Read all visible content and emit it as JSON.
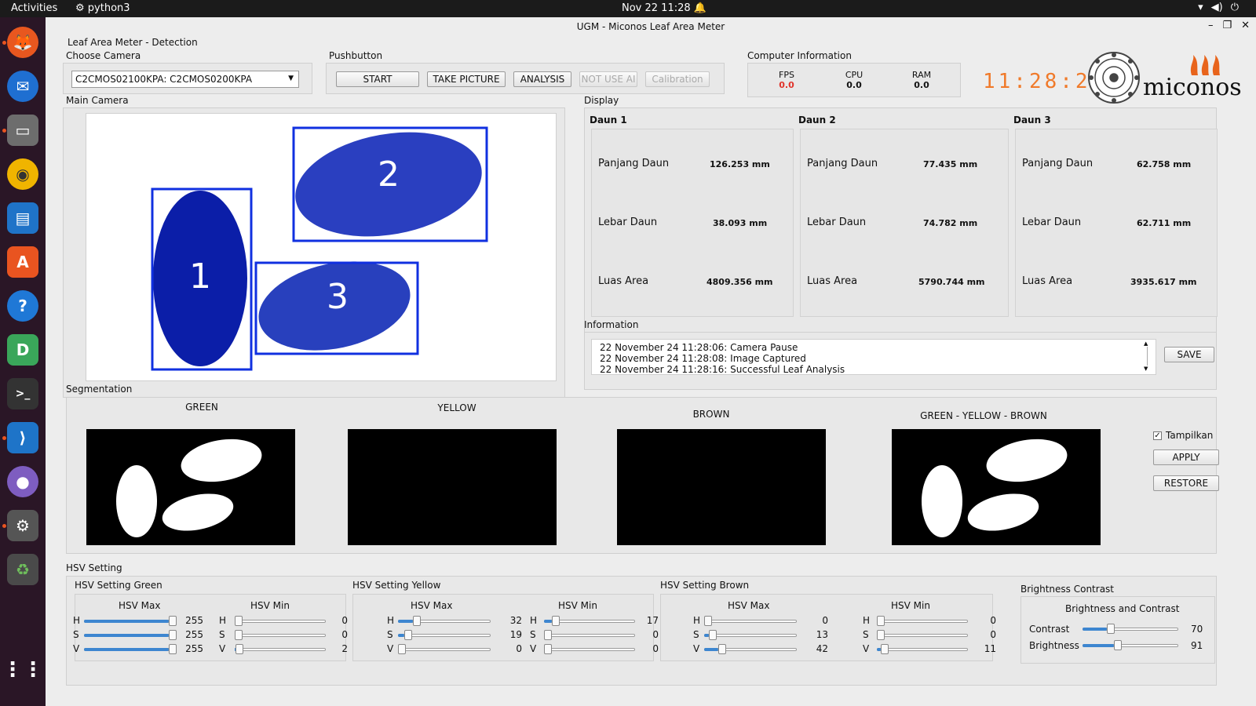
{
  "system": {
    "activities": "Activities",
    "app_name": "python3",
    "datetime": "Nov 22  11:28",
    "icons": [
      "wifi-icon",
      "volume-icon",
      "power-icon",
      "bell-icon"
    ]
  },
  "dock": {
    "apps": [
      "firefox-icon",
      "thunderbird-icon",
      "files-icon",
      "rhythmbox-icon",
      "writer-icon",
      "appcenter-icon",
      "help-icon",
      "dbeaver-icon",
      "terminal-icon",
      "vscode-icon",
      "camera-icon",
      "settings-icon",
      "trash-icon",
      "app-grid-icon"
    ]
  },
  "window": {
    "title": "UGM - Miconos Leaf Area Meter",
    "tab_label": "Leaf Area Meter - Detection"
  },
  "camera": {
    "label": "Choose Camera",
    "selected": "C2CMOS02100KPA: C2CMOS0200KPA"
  },
  "pushbutton": {
    "label": "Pushbutton",
    "start": "START",
    "take_picture": "TAKE PICTURE",
    "analysis": "ANALYSIS",
    "not_use_ai": "NOT USE AI",
    "calibration": "Calibration"
  },
  "computer_info": {
    "label": "Computer Information",
    "fps_label": "FPS",
    "fps": "0.0",
    "cpu_label": "CPU",
    "cpu": "0.0",
    "ram_label": "RAM",
    "ram": "0.0",
    "clock": "11:28:20",
    "logo_text": "miconos"
  },
  "main_camera": {
    "label": "Main Camera",
    "leaf_ids": [
      "1",
      "2",
      "3"
    ]
  },
  "display": {
    "label": "Display",
    "leaves": [
      {
        "title": "Daun 1",
        "panjang_label": "Panjang Daun",
        "panjang": "126.253 mm",
        "lebar_label": "Lebar Daun",
        "lebar": "38.093 mm",
        "luas_label": "Luas Area",
        "luas": "4809.356 mm"
      },
      {
        "title": "Daun 2",
        "panjang_label": "Panjang Daun",
        "panjang": "77.435 mm",
        "lebar_label": "Lebar Daun",
        "lebar": "74.782 mm",
        "luas_label": "Luas Area",
        "luas": "5790.744 mm"
      },
      {
        "title": "Daun 3",
        "panjang_label": "Panjang Daun",
        "panjang": "62.758 mm",
        "lebar_label": "Lebar Daun",
        "lebar": "62.711 mm",
        "luas_label": "Luas Area",
        "luas": "3935.617 mm"
      }
    ]
  },
  "information": {
    "label": "Information",
    "lines": [
      "22 November 24 11:28:06: Camera Pause",
      "22 November 24 11:28:08: Image Captured",
      "22 November 24 11:28:16: Successful Leaf Analysis"
    ],
    "save": "SAVE"
  },
  "segmentation": {
    "label": "Segmentation",
    "green": "GREEN",
    "yellow": "YELLOW",
    "brown": "BROWN",
    "combined": "GREEN - YELLOW - BROWN",
    "tampilkan": "Tampilkan",
    "tampilkan_checked": true,
    "apply": "APPLY",
    "restore": "RESTORE"
  },
  "hsv": {
    "label": "HSV Setting",
    "max_label": "HSV Max",
    "min_label": "HSV Min",
    "channel_labels": [
      "H",
      "S",
      "V"
    ],
    "green": {
      "title": "HSV Setting Green",
      "max": [
        255,
        255,
        255
      ],
      "min": [
        0,
        0,
        2
      ]
    },
    "yellow": {
      "title": "HSV Setting Yellow",
      "max": [
        32,
        19,
        0
      ],
      "min": [
        17,
        0,
        0
      ]
    },
    "brown": {
      "title": "HSV Setting Brown",
      "max": [
        0,
        13,
        42
      ],
      "min": [
        0,
        0,
        11
      ]
    }
  },
  "brightness": {
    "label": "Brightness Contrast",
    "title": "Brightness and Contrast",
    "contrast_label": "Contrast",
    "contrast": 70,
    "brightness_label": "Brightness",
    "brightness": 91
  }
}
